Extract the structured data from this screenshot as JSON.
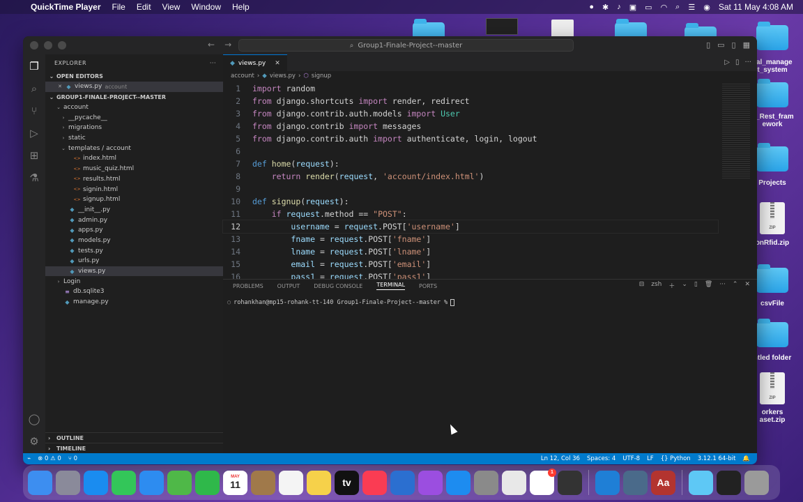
{
  "menubar": {
    "app_name": "QuickTime Player",
    "items": [
      "File",
      "Edit",
      "View",
      "Window",
      "Help"
    ],
    "datetime": "Sat 11 May  4:08 AM"
  },
  "desktop_icons": [
    {
      "label": "cal_manage\nt_system",
      "kind": "folder"
    },
    {
      "label": "o_Rest_fram\nework",
      "kind": "folder"
    },
    {
      "label": "Projects",
      "kind": "folder"
    },
    {
      "label": "onRfid.zip",
      "kind": "zip"
    },
    {
      "label": "csvFile",
      "kind": "folder"
    },
    {
      "label": "ntled folder",
      "kind": "folder"
    },
    {
      "label": "orkers\naset.zip",
      "kind": "zip"
    }
  ],
  "window": {
    "command_center": "Group1-Finale-Project--master"
  },
  "sidebar": {
    "title": "EXPLORER",
    "open_editors_label": "OPEN EDITORS",
    "open_editor": {
      "name": "views.py",
      "folder": "account"
    },
    "project_label": "GROUP1-FINALE-PROJECT--MASTER",
    "tree": [
      {
        "name": "account",
        "depth": 0,
        "kind": "folder-open"
      },
      {
        "name": "__pycache__",
        "depth": 1,
        "kind": "folder"
      },
      {
        "name": "migrations",
        "depth": 1,
        "kind": "folder"
      },
      {
        "name": "static",
        "depth": 1,
        "kind": "folder"
      },
      {
        "name": "templates / account",
        "depth": 1,
        "kind": "folder-open"
      },
      {
        "name": "index.html",
        "depth": 2,
        "kind": "html"
      },
      {
        "name": "music_quiz.html",
        "depth": 2,
        "kind": "html"
      },
      {
        "name": "results.html",
        "depth": 2,
        "kind": "html"
      },
      {
        "name": "signin.html",
        "depth": 2,
        "kind": "html"
      },
      {
        "name": "signup.html",
        "depth": 2,
        "kind": "html"
      },
      {
        "name": "__init__.py",
        "depth": 1,
        "kind": "py"
      },
      {
        "name": "admin.py",
        "depth": 1,
        "kind": "py"
      },
      {
        "name": "apps.py",
        "depth": 1,
        "kind": "py"
      },
      {
        "name": "models.py",
        "depth": 1,
        "kind": "py"
      },
      {
        "name": "tests.py",
        "depth": 1,
        "kind": "py"
      },
      {
        "name": "urls.py",
        "depth": 1,
        "kind": "py"
      },
      {
        "name": "views.py",
        "depth": 1,
        "kind": "py",
        "selected": true
      },
      {
        "name": "Login",
        "depth": 0,
        "kind": "folder"
      },
      {
        "name": "db.sqlite3",
        "depth": 0,
        "kind": "db"
      },
      {
        "name": "manage.py",
        "depth": 0,
        "kind": "py"
      }
    ],
    "outline_label": "OUTLINE",
    "timeline_label": "TIMELINE"
  },
  "editor": {
    "tab_label": "views.py",
    "breadcrumb": [
      "account",
      "views.py",
      "signup"
    ],
    "current_line": 12
  },
  "code_lines": [
    [
      [
        "kw",
        "import"
      ],
      [
        "txt",
        " random"
      ]
    ],
    [
      [
        "kw",
        "from"
      ],
      [
        "txt",
        " django.shortcuts "
      ],
      [
        "kw",
        "import"
      ],
      [
        "txt",
        " render, redirect"
      ]
    ],
    [
      [
        "kw",
        "from"
      ],
      [
        "txt",
        " django.contrib.auth.models "
      ],
      [
        "kw",
        "import"
      ],
      [
        "txt",
        " "
      ],
      [
        "mod",
        "User"
      ]
    ],
    [
      [
        "kw",
        "from"
      ],
      [
        "txt",
        " django.contrib "
      ],
      [
        "kw",
        "import"
      ],
      [
        "txt",
        " messages"
      ]
    ],
    [
      [
        "kw",
        "from"
      ],
      [
        "txt",
        " django.contrib.auth "
      ],
      [
        "kw",
        "import"
      ],
      [
        "txt",
        " authenticate, login, logout"
      ]
    ],
    [],
    [
      [
        "df",
        "def"
      ],
      [
        "txt",
        " "
      ],
      [
        "fn",
        "home"
      ],
      [
        "txt",
        "("
      ],
      [
        "var",
        "request"
      ],
      [
        "txt",
        "):"
      ]
    ],
    [
      [
        "txt",
        "    "
      ],
      [
        "kw",
        "return"
      ],
      [
        "txt",
        " "
      ],
      [
        "fn",
        "render"
      ],
      [
        "txt",
        "("
      ],
      [
        "var",
        "request"
      ],
      [
        "txt",
        ", "
      ],
      [
        "str",
        "'account/index.html'"
      ],
      [
        "txt",
        ")"
      ]
    ],
    [],
    [
      [
        "df",
        "def"
      ],
      [
        "txt",
        " "
      ],
      [
        "fn",
        "signup"
      ],
      [
        "txt",
        "("
      ],
      [
        "var",
        "request"
      ],
      [
        "txt",
        "):"
      ]
    ],
    [
      [
        "txt",
        "    "
      ],
      [
        "kw",
        "if"
      ],
      [
        "txt",
        " "
      ],
      [
        "var",
        "request"
      ],
      [
        "txt",
        ".method == "
      ],
      [
        "str",
        "\"POST\""
      ],
      [
        "txt",
        ":"
      ]
    ],
    [
      [
        "txt",
        "        "
      ],
      [
        "var",
        "username"
      ],
      [
        "txt",
        " = "
      ],
      [
        "var",
        "request"
      ],
      [
        "txt",
        ".POST["
      ],
      [
        "str",
        "'username'"
      ],
      [
        "txt",
        "]"
      ]
    ],
    [
      [
        "txt",
        "        "
      ],
      [
        "var",
        "fname"
      ],
      [
        "txt",
        " = "
      ],
      [
        "var",
        "request"
      ],
      [
        "txt",
        ".POST["
      ],
      [
        "str",
        "'fname'"
      ],
      [
        "txt",
        "]"
      ]
    ],
    [
      [
        "txt",
        "        "
      ],
      [
        "var",
        "lname"
      ],
      [
        "txt",
        " = "
      ],
      [
        "var",
        "request"
      ],
      [
        "txt",
        ".POST["
      ],
      [
        "str",
        "'lname'"
      ],
      [
        "txt",
        "]"
      ]
    ],
    [
      [
        "txt",
        "        "
      ],
      [
        "var",
        "email"
      ],
      [
        "txt",
        " = "
      ],
      [
        "var",
        "request"
      ],
      [
        "txt",
        ".POST["
      ],
      [
        "str",
        "'email'"
      ],
      [
        "txt",
        "]"
      ]
    ],
    [
      [
        "txt",
        "        "
      ],
      [
        "var",
        "pass1"
      ],
      [
        "txt",
        " = "
      ],
      [
        "var",
        "request"
      ],
      [
        "txt",
        ".POST["
      ],
      [
        "str",
        "'pass1'"
      ],
      [
        "txt",
        "]"
      ]
    ]
  ],
  "panel": {
    "tabs": [
      "PROBLEMS",
      "OUTPUT",
      "DEBUG CONSOLE",
      "TERMINAL",
      "PORTS"
    ],
    "active_tab": "TERMINAL",
    "shell": "zsh",
    "prompt": "rohankhan@mp15-rohank-tt-140 Group1-Finale-Project--master %"
  },
  "statusbar": {
    "errors": "0",
    "warnings": "0",
    "ports": "0",
    "position": "Ln 12, Col 36",
    "spaces": "Spaces: 4",
    "encoding": "UTF-8",
    "eol": "LF",
    "language": "Python",
    "interpreter": "3.12.1 64-bit"
  },
  "dock": {
    "apps": [
      {
        "name": "finder",
        "label": "",
        "color": "#3d8ef0"
      },
      {
        "name": "launchpad",
        "label": "",
        "color": "#8a8a9a"
      },
      {
        "name": "safari",
        "label": "",
        "color": "#1a8cf0"
      },
      {
        "name": "messages",
        "label": "",
        "color": "#33c659"
      },
      {
        "name": "mail",
        "label": "",
        "color": "#2d8cf0"
      },
      {
        "name": "maps",
        "label": "",
        "color": "#4fb848"
      },
      {
        "name": "facetime",
        "label": "",
        "color": "#2fb84a"
      },
      {
        "name": "calendar",
        "label": "11",
        "color": "#ffffff"
      },
      {
        "name": "notes-brown",
        "label": "",
        "color": "#a0794a"
      },
      {
        "name": "reminders",
        "label": "",
        "color": "#f4f4f4"
      },
      {
        "name": "notes",
        "label": "",
        "color": "#f6d14a"
      },
      {
        "name": "apple-tv",
        "label": "tv",
        "color": "#111111"
      },
      {
        "name": "music",
        "label": "",
        "color": "#fa3c53"
      },
      {
        "name": "support",
        "label": "",
        "color": "#2b6fd0"
      },
      {
        "name": "podcasts",
        "label": "",
        "color": "#9b4ee0"
      },
      {
        "name": "app-store",
        "label": "",
        "color": "#1d8cf0"
      },
      {
        "name": "system-settings",
        "label": "",
        "color": "#8a8a8a"
      },
      {
        "name": "chrome",
        "label": "",
        "color": "#e8e8e8"
      },
      {
        "name": "slack",
        "label": "",
        "color": "#ffffff",
        "badge": "1"
      },
      {
        "name": "pen-tool",
        "label": "",
        "color": "#333333"
      },
      {
        "name": "vscode",
        "label": "",
        "color": "#1f7fd6"
      },
      {
        "name": "quicktime",
        "label": "",
        "color": "#4a6a8a"
      },
      {
        "name": "dictionary",
        "label": "Aa",
        "color": "#b3342f"
      },
      {
        "name": "downloads-folder",
        "label": "",
        "color": "#5ec8f5"
      },
      {
        "name": "recent-window",
        "label": "",
        "color": "#222222"
      },
      {
        "name": "trash",
        "label": "",
        "color": "#9a9a9a"
      }
    ],
    "calendar_month": "MAY"
  }
}
